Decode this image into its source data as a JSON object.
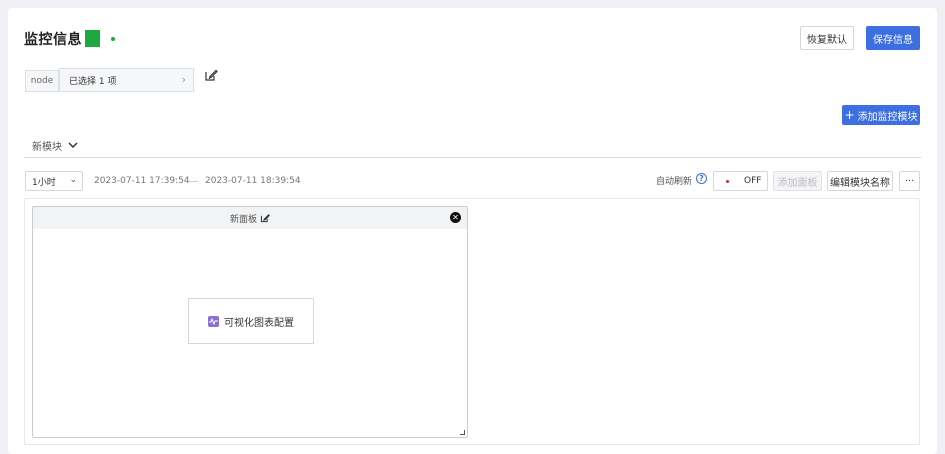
{
  "header": {
    "title": "监控信息",
    "status_color": "#1fa83f",
    "restore_label": "恢复默认",
    "save_label": "保存信息"
  },
  "filter": {
    "node_tag": "node",
    "selection_text": "已选择 1 项",
    "chevron_icon": "chevron-right-icon",
    "edit_icon": "edit-icon"
  },
  "add_module_label": "添加监控模块",
  "module": {
    "name": "新模块",
    "time_range": "1小时",
    "start_time": "2023-07-11 17:39:54",
    "end_time": "2023-07-11 18:39:54",
    "auto_refresh_label": "自动刷新",
    "auto_refresh_state": "OFF",
    "add_panel_label": "添加面板",
    "edit_name_label": "编辑模块名称",
    "more_label": "···"
  },
  "panel": {
    "title": "新面板",
    "config_label": "可视化图表配置"
  },
  "colors": {
    "accent": "#3e6fe0",
    "status": "#1fa83f",
    "chart_icon": "#8a6fd6"
  }
}
